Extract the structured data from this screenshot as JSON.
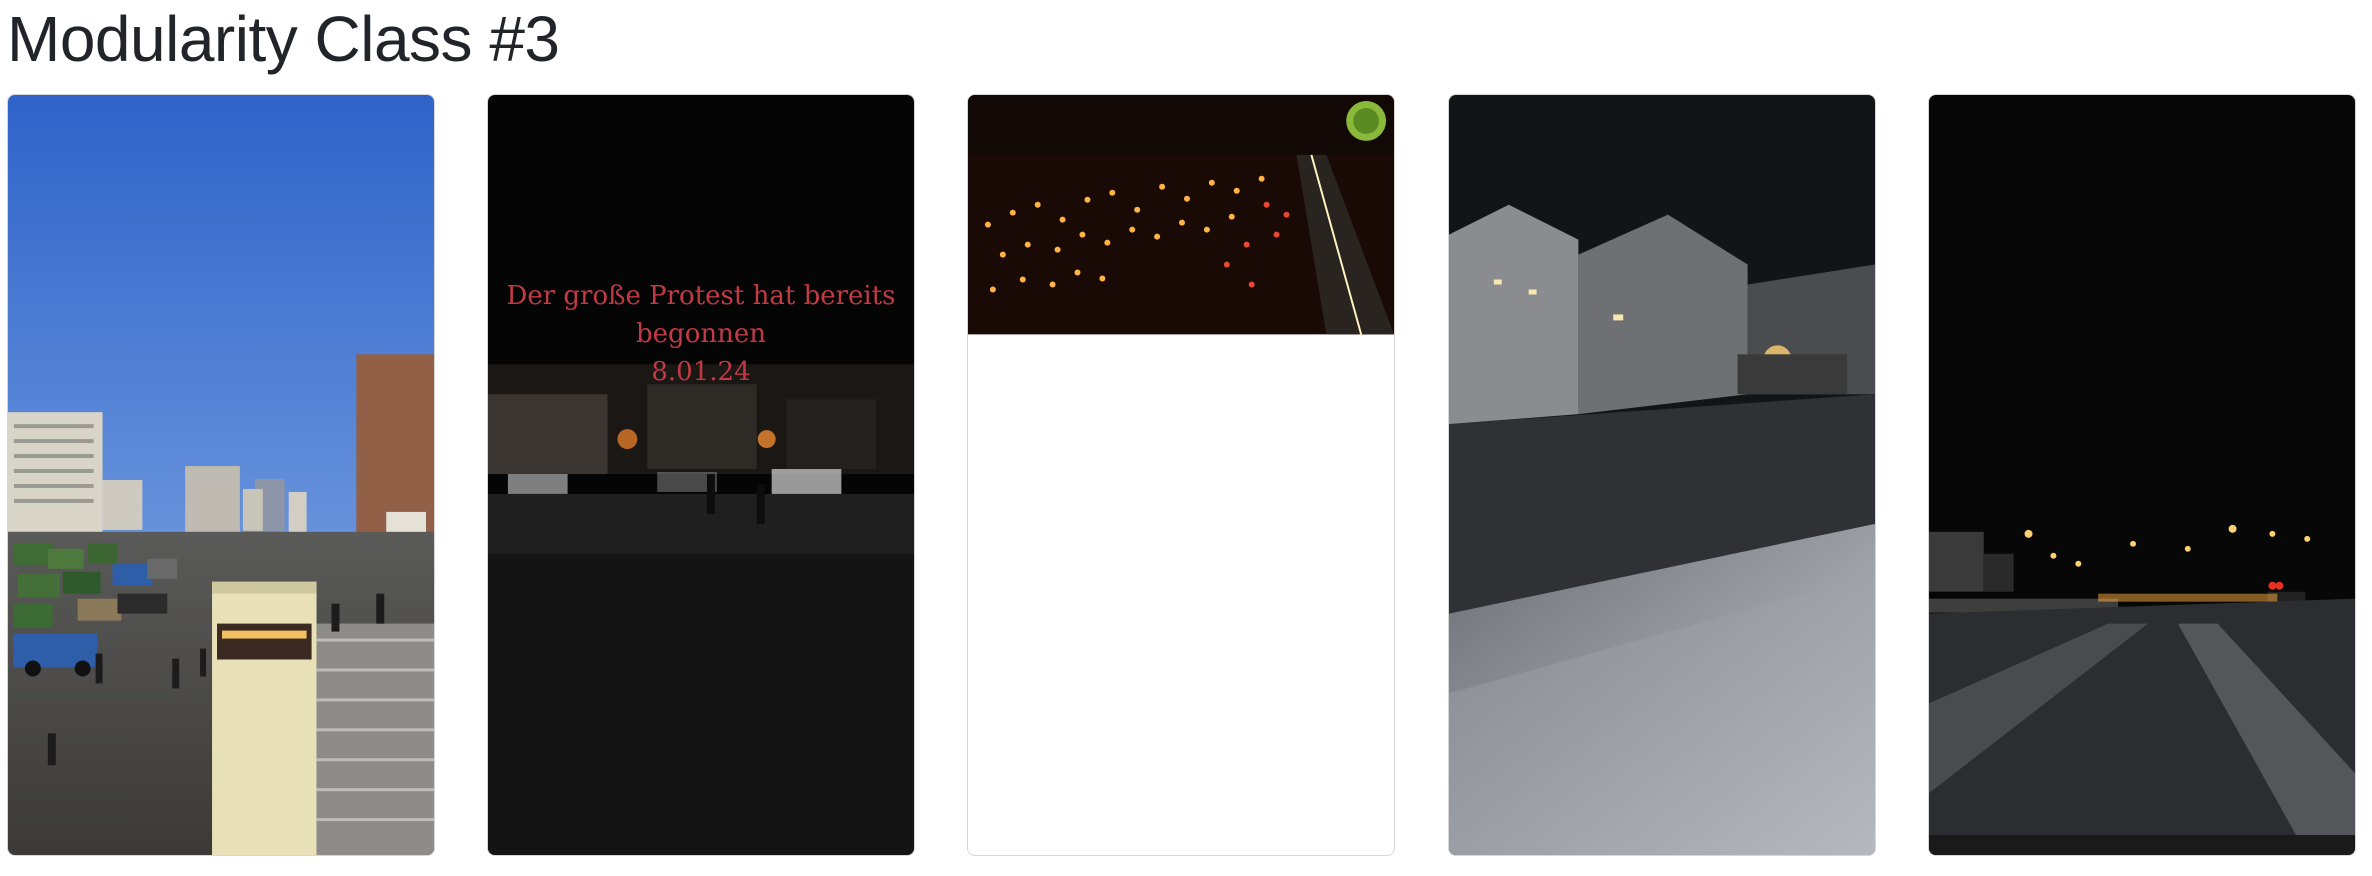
{
  "page": {
    "title": "Modularity Class #3"
  },
  "cards": [
    {
      "icon": "photo-thumbnail"
    },
    {
      "icon": "video-thumbnail",
      "overlay_lines": [
        "Der große Protest hat bereits",
        "begonnen",
        "8.01.24"
      ]
    },
    {
      "icon": "video-thumbnail"
    },
    {
      "icon": "video-thumbnail"
    },
    {
      "icon": "video-thumbnail"
    }
  ],
  "colors": {
    "overlay_text": "#c23a44",
    "card_border": "#d6d6d6",
    "title": "#212529"
  }
}
